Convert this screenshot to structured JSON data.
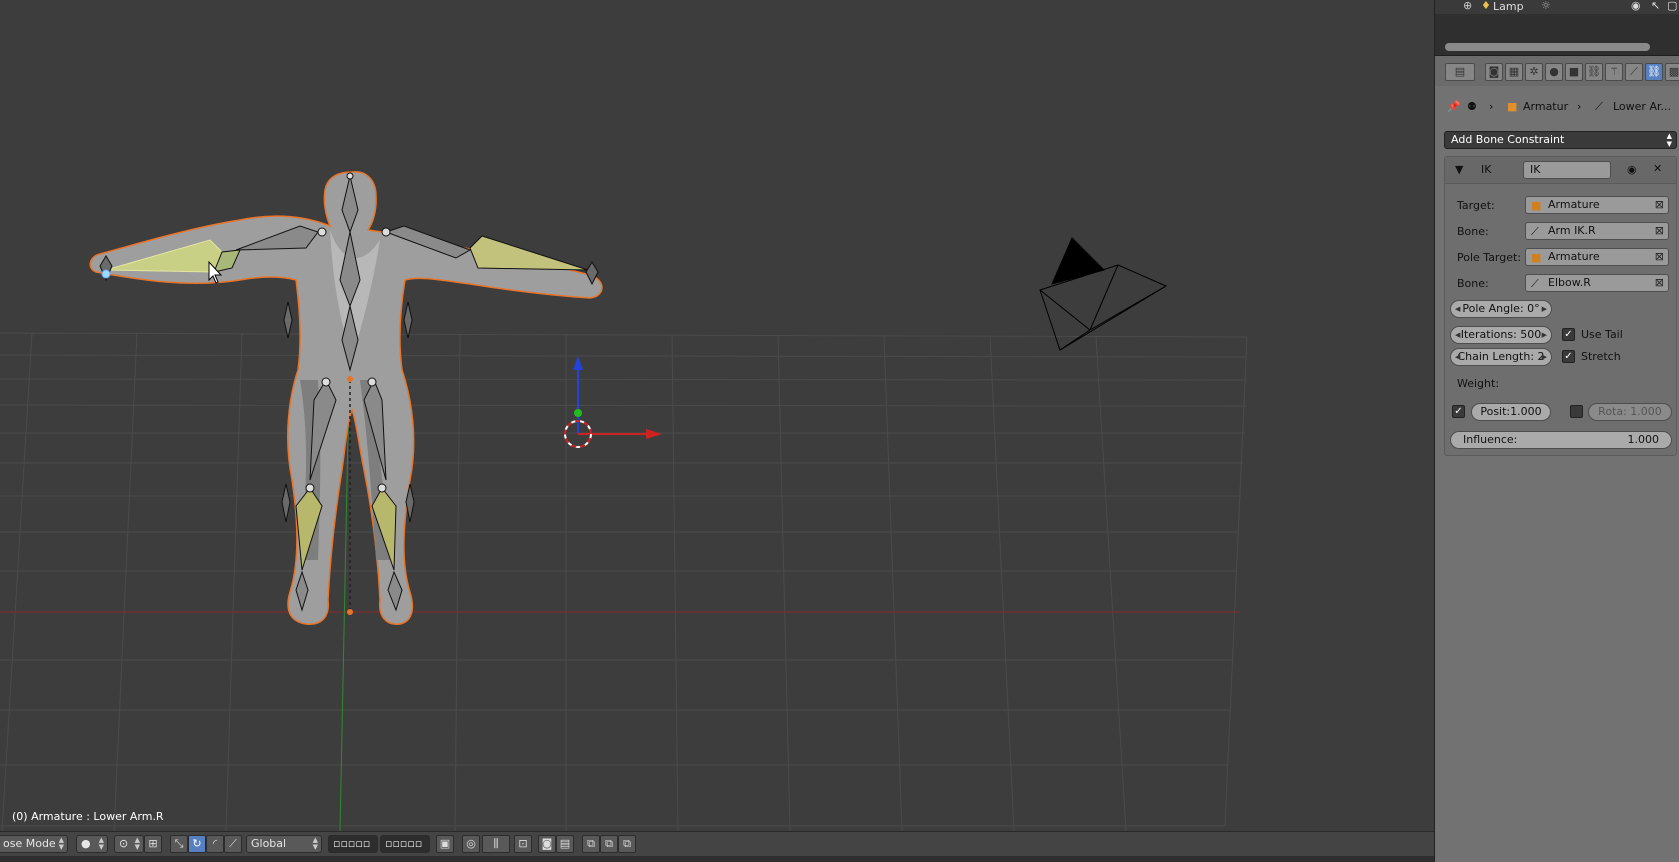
{
  "viewport": {
    "info": "(0) Armature : Lower Arm.R"
  },
  "header": {
    "mode_label": "ose Mode",
    "orientation_label": "Global"
  },
  "outliner": {
    "row_label": "Lamp"
  },
  "breadcrumb": {
    "object": "Armatur",
    "bone": "Lower Ar..."
  },
  "constraints": {
    "add_label": "Add Bone Constraint",
    "ik": {
      "type_label": "IK",
      "name_value": "IK",
      "target_label": "Target:",
      "target_value": "Armature",
      "bone_label": "Bone:",
      "bone_value": "Arm IK.R",
      "pole_target_label": "Pole Target:",
      "pole_target_value": "Armature",
      "pole_bone_label": "Bone:",
      "pole_bone_value": "Elbow.R",
      "pole_angle": "Pole Angle:   0°",
      "iterations": "Iterations:  500",
      "chain_length": "Chain Length: 2",
      "use_tail_label": "Use Tail",
      "stretch_label": "Stretch",
      "weight_label": "Weight:",
      "position_weight": "Posit:1.000",
      "rotation_weight": "Rota: 1.000",
      "influence_label": "Influence:",
      "influence_value": "1.000"
    }
  },
  "colors": {
    "viewport_bg": "#3d3d3d",
    "grid": "#4a4a4a",
    "selection_outline": "#e8742a",
    "bone_selected": "#c8c878",
    "active_button": "#5680c2",
    "axis_x": "#cc2222",
    "axis_y": "#22aa22",
    "axis_z": "#2244dd"
  },
  "icons": [
    "armature-icon",
    "bone-icon",
    "pin-icon",
    "eye-icon",
    "close-icon",
    "camera-icon",
    "lamp-icon",
    "cursor-icon",
    "manipulator-icon"
  ]
}
